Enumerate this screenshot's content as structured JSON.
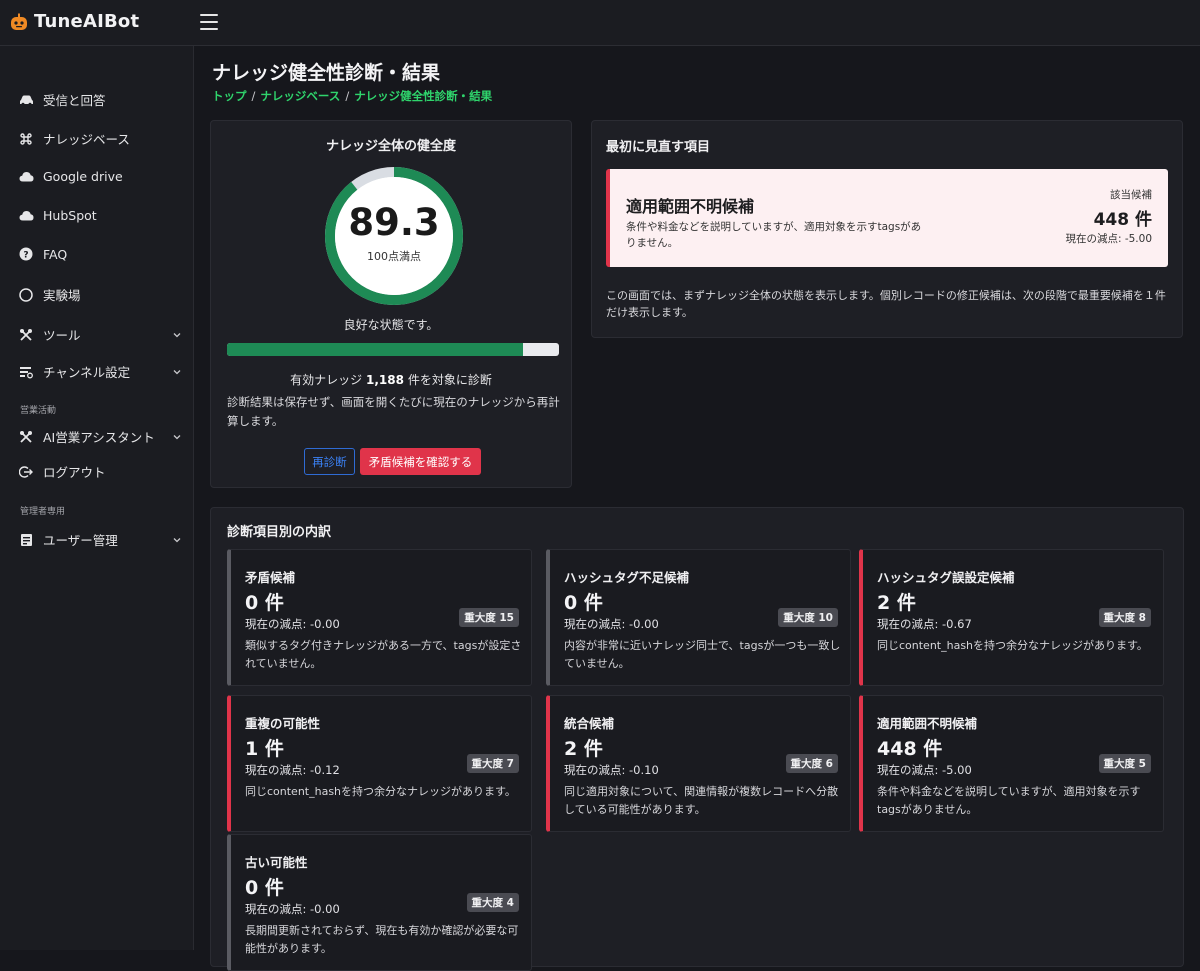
{
  "app": {
    "name": "TuneAIBot"
  },
  "sidebar": {
    "items": [
      {
        "label": "受信と回答",
        "icon": "car-icon"
      },
      {
        "label": "ナレッジベース",
        "icon": "command-icon"
      },
      {
        "label": "Google drive",
        "icon": "cloud-icon"
      },
      {
        "label": "HubSpot",
        "icon": "cloud-icon"
      },
      {
        "label": "FAQ",
        "icon": "question-icon"
      },
      {
        "label": "実験場",
        "icon": "circle-icon"
      },
      {
        "label": "ツール",
        "icon": "tools-icon"
      },
      {
        "label": "チャンネル設定",
        "icon": "channel-icon"
      },
      {
        "label": "AI営業アシスタント",
        "icon": "tools-icon"
      },
      {
        "label": "ログアウト",
        "icon": "logout-icon"
      },
      {
        "label": "ユーザー管理",
        "icon": "user-manage-icon"
      }
    ],
    "sections": {
      "sales": "営業活動",
      "admin": "管理者専用"
    }
  },
  "page": {
    "title": "ナレッジ健全性診断・結果"
  },
  "breadcrumb": [
    "トップ",
    "ナレッジベース",
    "ナレッジ健全性診断・結果"
  ],
  "health": {
    "title": "ナレッジ全体の健全度",
    "score": "89.3",
    "score_sub": "100点満点",
    "score_value": 89.3,
    "status": "良好な状態です。",
    "progress": 0.893,
    "target_prefix": "有効ナレッジ",
    "target_count": "1,188",
    "target_suffix": "件を対象に診断",
    "note": "診断結果は保存せず、画面を開くたびに現在のナレッジから再計算します。",
    "rediagnose_label": "再診断",
    "confirm_label": "矛盾候補を確認する"
  },
  "priority": {
    "title": "最初に見直す項目",
    "name": "適用範囲不明候補",
    "desc": "条件や料金などを説明していますが、適用対象を示すtagsがありません。",
    "count_label": "該当候補",
    "count": "448 件",
    "deduction": "現在の減点: -5.00",
    "note": "この画面では、まずナレッジ全体の状態を表示します。個別レコードの修正候補は、次の段階で最重要候補を１件だけ表示します。"
  },
  "breakdown": {
    "title": "診断項目別の内訳",
    "items": [
      {
        "name": "矛盾候補",
        "count": "0 件",
        "deduction": "現在の減点: -0.00",
        "severity": "重大度 15",
        "desc": "類似するタグ付きナレッジがある一方で、tagsが設定されていません。",
        "accent": "#5a5b62"
      },
      {
        "name": "ハッシュタグ不足候補",
        "count": "0 件",
        "deduction": "現在の減点: -0.00",
        "severity": "重大度 10",
        "desc": "内容が非常に近いナレッジ同士で、tagsが一つも一致していません。",
        "accent": "#5a5b62"
      },
      {
        "name": "ハッシュタグ誤設定候補",
        "count": "2 件",
        "deduction": "現在の減点: -0.67",
        "severity": "重大度 8",
        "desc": "同じcontent_hashを持つ余分なナレッジがあります。",
        "accent": "#e0344a"
      },
      {
        "name": "重複の可能性",
        "count": "1 件",
        "deduction": "現在の減点: -0.12",
        "severity": "重大度 7",
        "desc": "同じcontent_hashを持つ余分なナレッジがあります。",
        "accent": "#e0344a"
      },
      {
        "name": "統合候補",
        "count": "2 件",
        "deduction": "現在の減点: -0.10",
        "severity": "重大度 6",
        "desc": "同じ適用対象について、関連情報が複数レコードへ分散している可能性があります。",
        "accent": "#e0344a"
      },
      {
        "name": "適用範囲不明候補",
        "count": "448 件",
        "deduction": "現在の減点: -5.00",
        "severity": "重大度 5",
        "desc": "条件や料金などを説明していますが、適用対象を示すtagsがありません。",
        "accent": "#e0344a"
      },
      {
        "name": "古い可能性",
        "count": "0 件",
        "deduction": "現在の減点: -0.00",
        "severity": "重大度 4",
        "desc": "長期間更新されておらず、現在も有効か確認が必要な可能性があります。",
        "accent": "#5a5b62"
      }
    ]
  },
  "colors": {
    "accent_green": "#2fd46c",
    "gauge_green": "#1e8a55",
    "danger": "#e0344a",
    "primary": "#3b82f6"
  }
}
